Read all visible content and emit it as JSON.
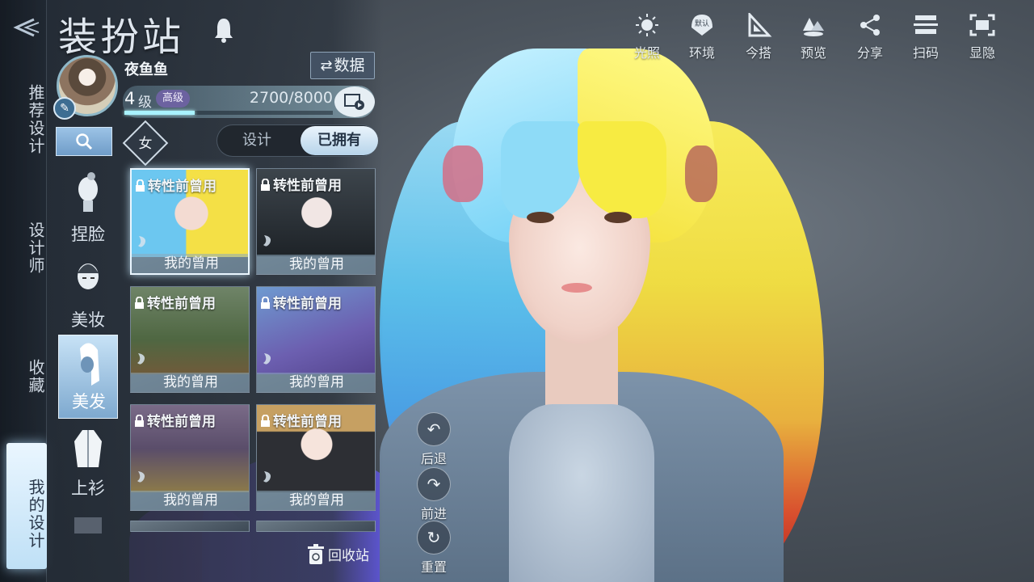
{
  "header": {
    "title": "装扮站",
    "back_icon": "back-arrow-icon",
    "bell_icon": "bell-icon"
  },
  "left_nav": {
    "items": [
      {
        "label": "推荐设计",
        "active": false
      },
      {
        "label": "设计师",
        "active": false
      },
      {
        "label": "收藏",
        "active": false
      },
      {
        "label": "我的设计",
        "active": true
      }
    ]
  },
  "profile": {
    "name": "夜鱼鱼",
    "level": "4",
    "level_unit": "级",
    "level_badge": "高级",
    "exp_text": "2700/8000",
    "exp_current": 2700,
    "exp_max": 8000,
    "data_button": "数据"
  },
  "filters": {
    "gender": "女",
    "tabs": [
      {
        "label": "设计",
        "active": false
      },
      {
        "label": "已拥有",
        "active": true
      }
    ]
  },
  "categories": [
    {
      "label": "捏脸",
      "active": false
    },
    {
      "label": "美妆",
      "active": false
    },
    {
      "label": "美发",
      "active": true
    },
    {
      "label": "上衫",
      "active": false
    }
  ],
  "items": [
    {
      "tag": "转性前曾用",
      "name": "我的曾用",
      "selected": true
    },
    {
      "tag": "转性前曾用",
      "name": "我的曾用",
      "selected": false
    },
    {
      "tag": "转性前曾用",
      "name": "我的曾用",
      "selected": false
    },
    {
      "tag": "转性前曾用",
      "name": "我的曾用",
      "selected": false
    },
    {
      "tag": "转性前曾用",
      "name": "我的曾用",
      "selected": false
    },
    {
      "tag": "转性前曾用",
      "name": "我的曾用",
      "selected": false
    }
  ],
  "recycle": {
    "label": "回收站"
  },
  "edit_controls": {
    "undo": "后退",
    "redo": "前进",
    "reset": "重置"
  },
  "toolbar": {
    "light": "光照",
    "environment": "环境",
    "environment_badge": "默认",
    "today": "今搭",
    "preview": "预览",
    "share": "分享",
    "scan": "扫码",
    "toggle": "显隐"
  },
  "colors": {
    "accent": "#a9f2ff",
    "active_tab": "#d6e8f6",
    "badge": "#6c62a0"
  }
}
